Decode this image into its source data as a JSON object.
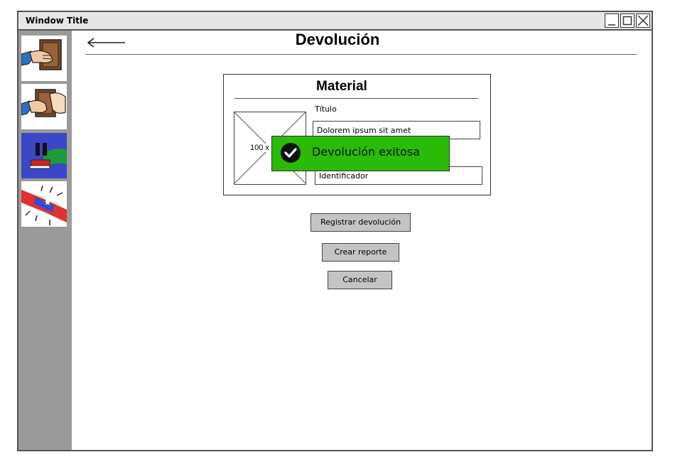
{
  "window": {
    "title": "Window Title"
  },
  "colors": {
    "sidebar": "#9a9a9a",
    "toast": "#2aba08",
    "button": "#c4c4c4",
    "titlebar": "#e6e6e6"
  },
  "sidebar": {
    "items": [
      {
        "icon": "hand-giving-book-icon"
      },
      {
        "icon": "hands-exchanging-book-icon"
      },
      {
        "icon": "pause-book-icon"
      },
      {
        "icon": "alert-siren-icon"
      }
    ]
  },
  "header": {
    "title": "Devolución",
    "back_icon": "back-arrow-icon"
  },
  "material": {
    "title": "Material",
    "image_placeholder": "100 x 100",
    "titulo_label": "Título",
    "titulo_value": "Dolorem ipsum sit amet",
    "identificador_value": "Identificador"
  },
  "toast": {
    "message": "Devolución exitosa",
    "icon": "check-circle-icon"
  },
  "actions": {
    "registrar": "Registrar devolución",
    "crear_reporte": "Crear reporte",
    "cancelar": "Cancelar"
  }
}
